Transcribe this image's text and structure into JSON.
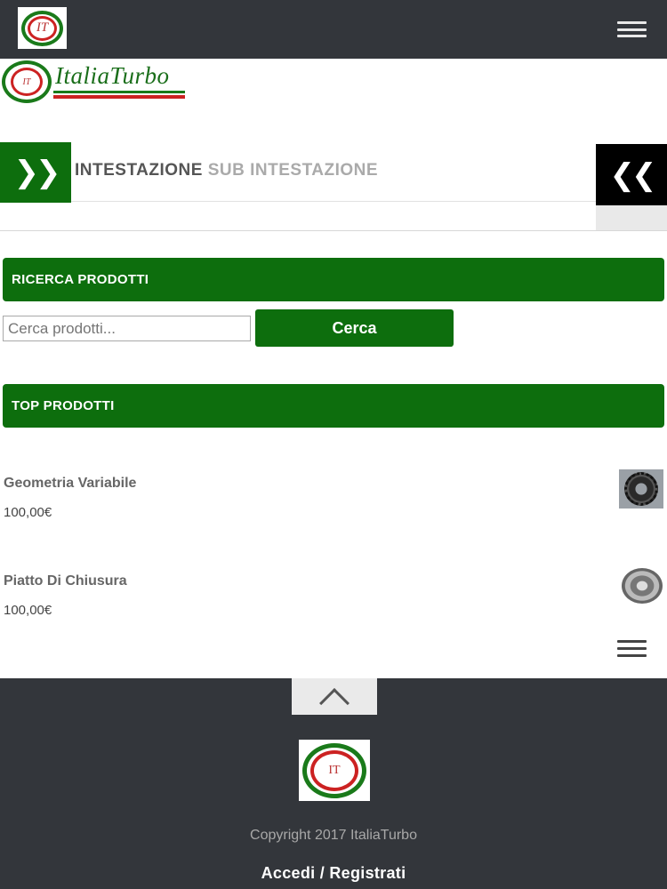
{
  "header": {
    "logo_text": "IT",
    "menu_icon": "hamburger-menu-icon"
  },
  "brand": {
    "logo_text": "IT",
    "name": "ItaliaTurbo",
    "stripe_colors": [
      "#1a7a1a",
      "#ffffff",
      "#cc2222"
    ]
  },
  "page_heading": {
    "expand_icon": "double-chevron-right-icon",
    "title": "INTESTAZIONE",
    "subtitle": "SUB INTESTAZIONE",
    "collapse_icon": "double-chevron-left-icon"
  },
  "search": {
    "section_title": "RICERCA PRODOTTI",
    "placeholder": "Cerca prodotti...",
    "button_label": "Cerca"
  },
  "top_products": {
    "section_title": "TOP PRODOTTI",
    "items": [
      {
        "name": "Geometria Variabile",
        "price": "100,00€",
        "thumb_icon": "turbo-geometry-part-thumbnail"
      },
      {
        "name": "Piatto Di Chiusura",
        "price": "100,00€",
        "thumb_icon": "closing-plate-part-thumbnail"
      }
    ]
  },
  "footer": {
    "logo_text": "IT",
    "copyright": "Copyright 2017 ItaliaTurbo",
    "login_label": "Accedi",
    "separator": "/",
    "register_label": "Registrati"
  },
  "colors": {
    "accent_green": "#0d6e0d",
    "dark_bar": "#33363b",
    "brand_red": "#cc2222"
  }
}
